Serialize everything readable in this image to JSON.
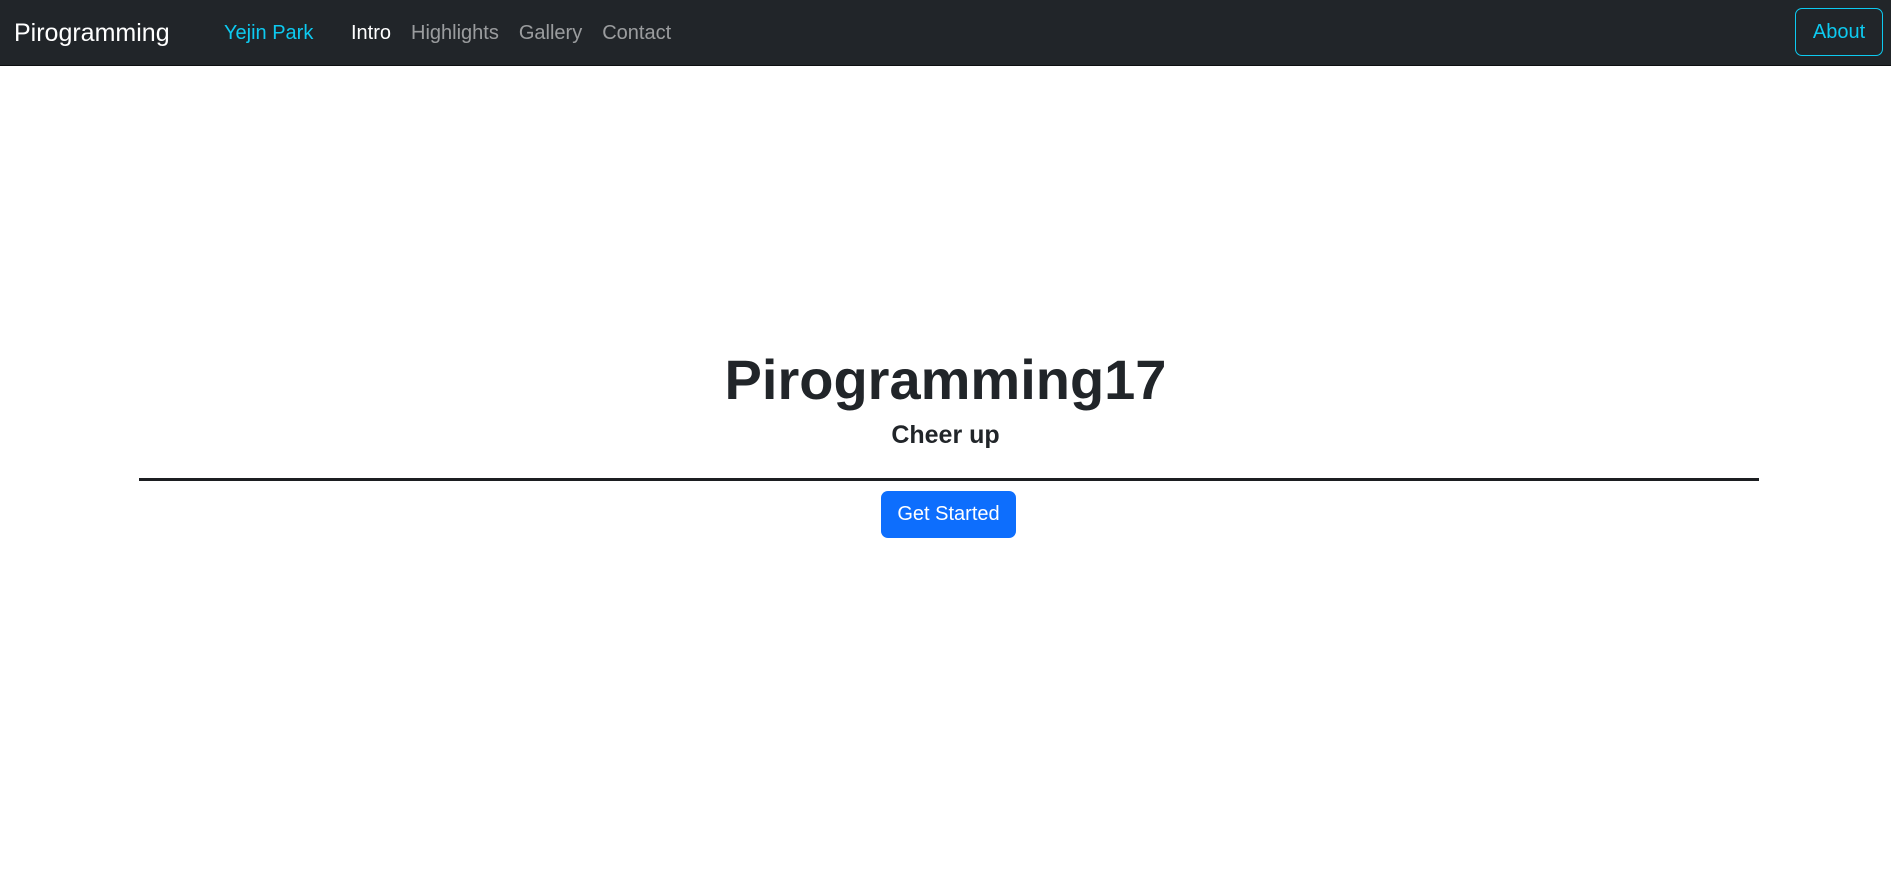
{
  "navbar": {
    "brand": "Pirogramming",
    "owner": "Yejin Park",
    "links": [
      {
        "label": "Intro",
        "active": true
      },
      {
        "label": "Highlights",
        "active": false
      },
      {
        "label": "Gallery",
        "active": false
      },
      {
        "label": "Contact",
        "active": false
      }
    ],
    "about_label": "About"
  },
  "hero": {
    "title": "Pirogramming17",
    "subtitle": "Cheer up",
    "cta_label": "Get Started"
  },
  "colors": {
    "navbar_bg": "#212529",
    "accent_info": "#0dcaf0",
    "primary": "#0d6efd",
    "text_dark": "#212529"
  }
}
